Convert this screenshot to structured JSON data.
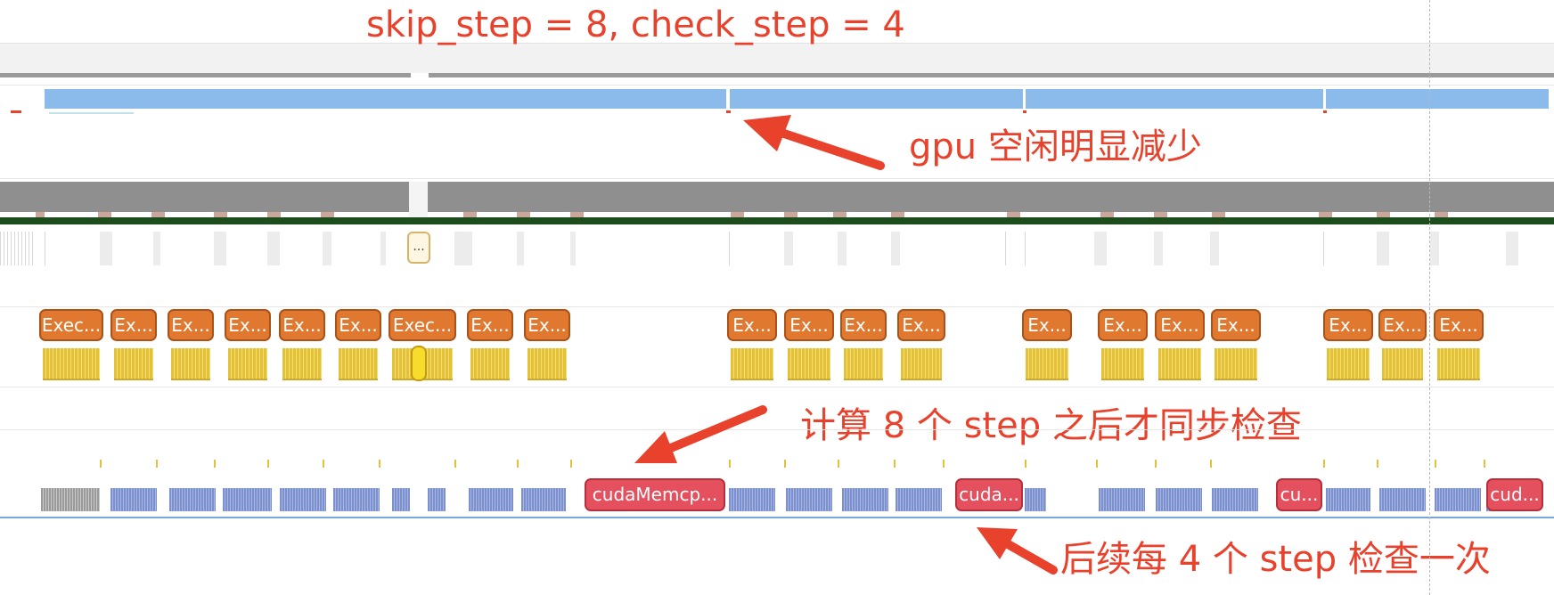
{
  "annotations": {
    "title": "skip_step = 8, check_step = 4",
    "gpu_idle": "gpu 空闲明显减少",
    "sync_after_8": "计算 8 个 step 之后才同步检查",
    "check_every_4": "后续每 4 个 step 检查一次"
  },
  "collapsed_marker": "...",
  "exec_labels": [
    "Exec...",
    "Ex...",
    "Ex...",
    "Ex...",
    "Ex...",
    "Ex...",
    "Exec...",
    "Ex...",
    "Ex...",
    "Ex...",
    "Ex...",
    "Ex...",
    "Ex...",
    "Ex...",
    "Ex...",
    "Ex...",
    "Ex...",
    "Ex...",
    "Ex...",
    "Ex..."
  ],
  "cuda_labels": [
    "cudaMemcp...",
    "cuda...",
    "cu...",
    "cud..."
  ],
  "colors": {
    "annotation": "#e8412c",
    "exec_block": "#e0782f",
    "cuda_block": "#e5505f",
    "gpu_activity": "#8bbbeb",
    "kernel_bars": "#e3c23a"
  }
}
